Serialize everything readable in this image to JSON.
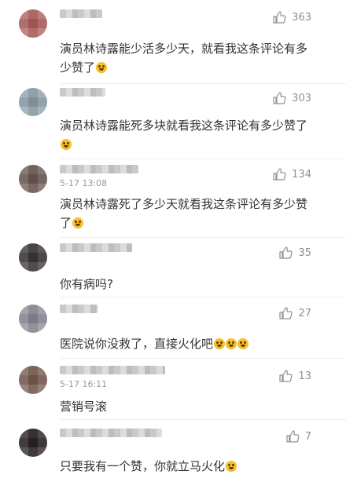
{
  "comments": [
    {
      "time": "",
      "likes": "363",
      "text": "演员林诗露能少活多少天，就看我这条评论有多少赞了",
      "emoji_count": 1,
      "avatar_color": "#b3615f"
    },
    {
      "time": "",
      "likes": "303",
      "text": "演员林诗露能死多块就看我这条评论有多少赞了",
      "emoji_count": 1,
      "avatar_color": "#8fa3ad"
    },
    {
      "time": "5-17 13:08",
      "likes": "134",
      "text": "演员林诗露死了多少天就看我这条评论有多少赞了",
      "emoji_count": 1,
      "avatar_color": "#6e5b54"
    },
    {
      "time": "",
      "likes": "35",
      "text": "你有病吗?",
      "emoji_count": 0,
      "avatar_color": "#3c3837"
    },
    {
      "time": "",
      "likes": "27",
      "text": "医院说你没救了，直接火化吧",
      "emoji_count": 3,
      "avatar_color": "#8d8d99"
    },
    {
      "time": "5-17 16:11",
      "likes": "13",
      "text": "营销号滚",
      "emoji_count": 0,
      "avatar_color": "#7b5d52"
    },
    {
      "time": "",
      "likes": "7",
      "text": "只要我有一个赞，你就立马火化",
      "emoji_count": 1,
      "avatar_color": "#2b2323"
    }
  ]
}
